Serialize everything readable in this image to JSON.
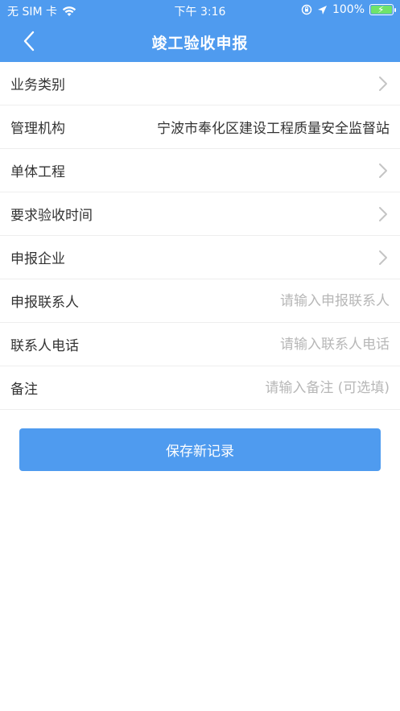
{
  "status_bar": {
    "carrier": "无 SIM 卡",
    "time": "下午 3:16",
    "battery": "100%"
  },
  "nav": {
    "title": "竣工验收申报"
  },
  "form": {
    "business_type_label": "业务类别",
    "management_org_label": "管理机构",
    "management_org_value": "宁波市奉化区建设工程质量安全监督站",
    "single_project_label": "单体工程",
    "required_time_label": "要求验收时间",
    "applicant_company_label": "申报企业",
    "contact_label": "申报联系人",
    "contact_placeholder": "请输入申报联系人",
    "phone_label": "联系人电话",
    "phone_placeholder": "请输入联系人电话",
    "remark_label": "备注",
    "remark_placeholder": "请输入备注 (可选填)"
  },
  "actions": {
    "save_label": "保存新记录"
  },
  "colors": {
    "accent": "#4f9bef"
  }
}
